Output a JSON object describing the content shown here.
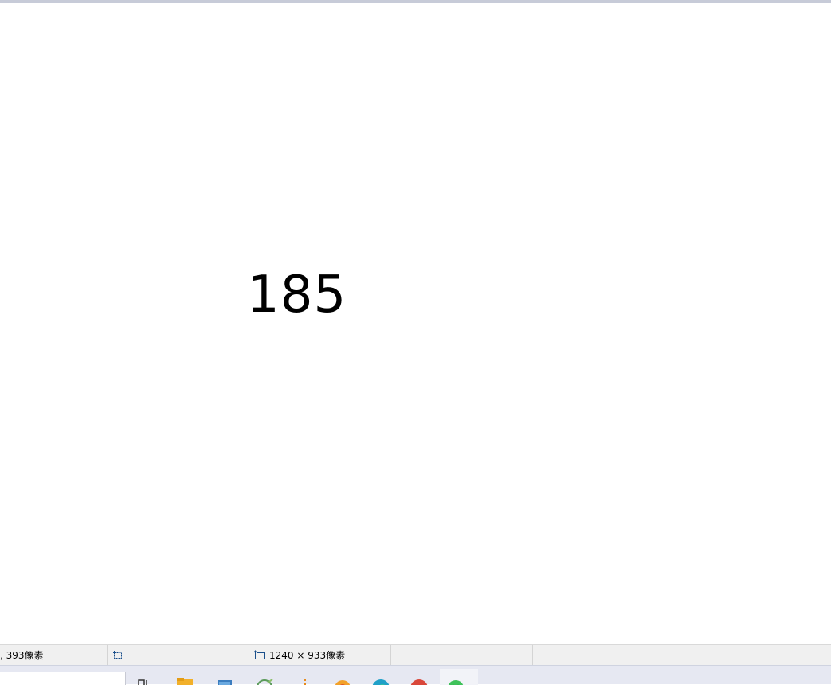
{
  "canvas": {
    "number_text": "185"
  },
  "statusbar": {
    "cursor_position": ", 393像素",
    "selection_size": "",
    "image_size": "1240 × 933像素",
    "file_size": "",
    "zoom": ""
  },
  "taskbar": {
    "apps": [
      {
        "icon": "task-view-icon"
      },
      {
        "icon": "file-explorer-icon"
      },
      {
        "icon": "app-blue-icon"
      },
      {
        "icon": "app-green-icon"
      },
      {
        "icon": "app-orange-icon"
      },
      {
        "icon": "app-folder-icon"
      },
      {
        "icon": "edge-icon"
      },
      {
        "icon": "chrome-icon"
      },
      {
        "icon": "wechat-icon"
      }
    ]
  },
  "colors": {
    "window_border": "#c7cbd8",
    "statusbar_bg": "#f0f0f0",
    "taskbar_bg": "#e6e8f2"
  }
}
